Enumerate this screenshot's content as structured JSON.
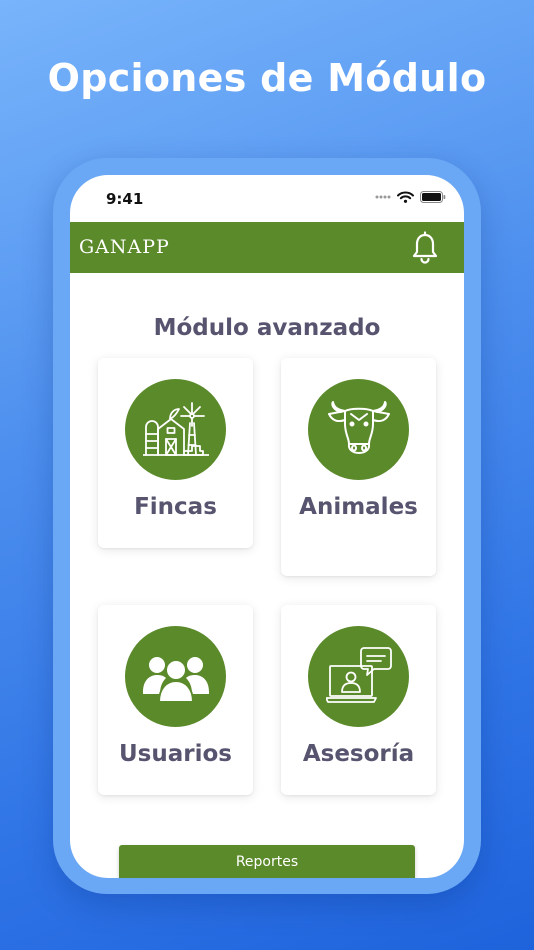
{
  "promo": {
    "headline": "Opciones de Módulo"
  },
  "status_bar": {
    "time": "9:41",
    "icons": [
      "signal-dots-icon",
      "wifi-icon",
      "battery-icon"
    ]
  },
  "app_bar": {
    "title": "GANAPP",
    "icon": "bell-icon"
  },
  "main": {
    "section_title": "Módulo avanzado",
    "cards": [
      {
        "label": "Fincas",
        "icon": "farm-icon"
      },
      {
        "label": "Animales",
        "icon": "cow-head-icon"
      },
      {
        "label": "Usuarios",
        "icon": "users-group-icon"
      },
      {
        "label": "Asesoría",
        "icon": "online-advisor-icon"
      }
    ],
    "reports_button": "Reportes"
  },
  "colors": {
    "brand_green": "#5b8a2b",
    "text_gray": "#56546e",
    "background_blue": "#3d82ea"
  }
}
